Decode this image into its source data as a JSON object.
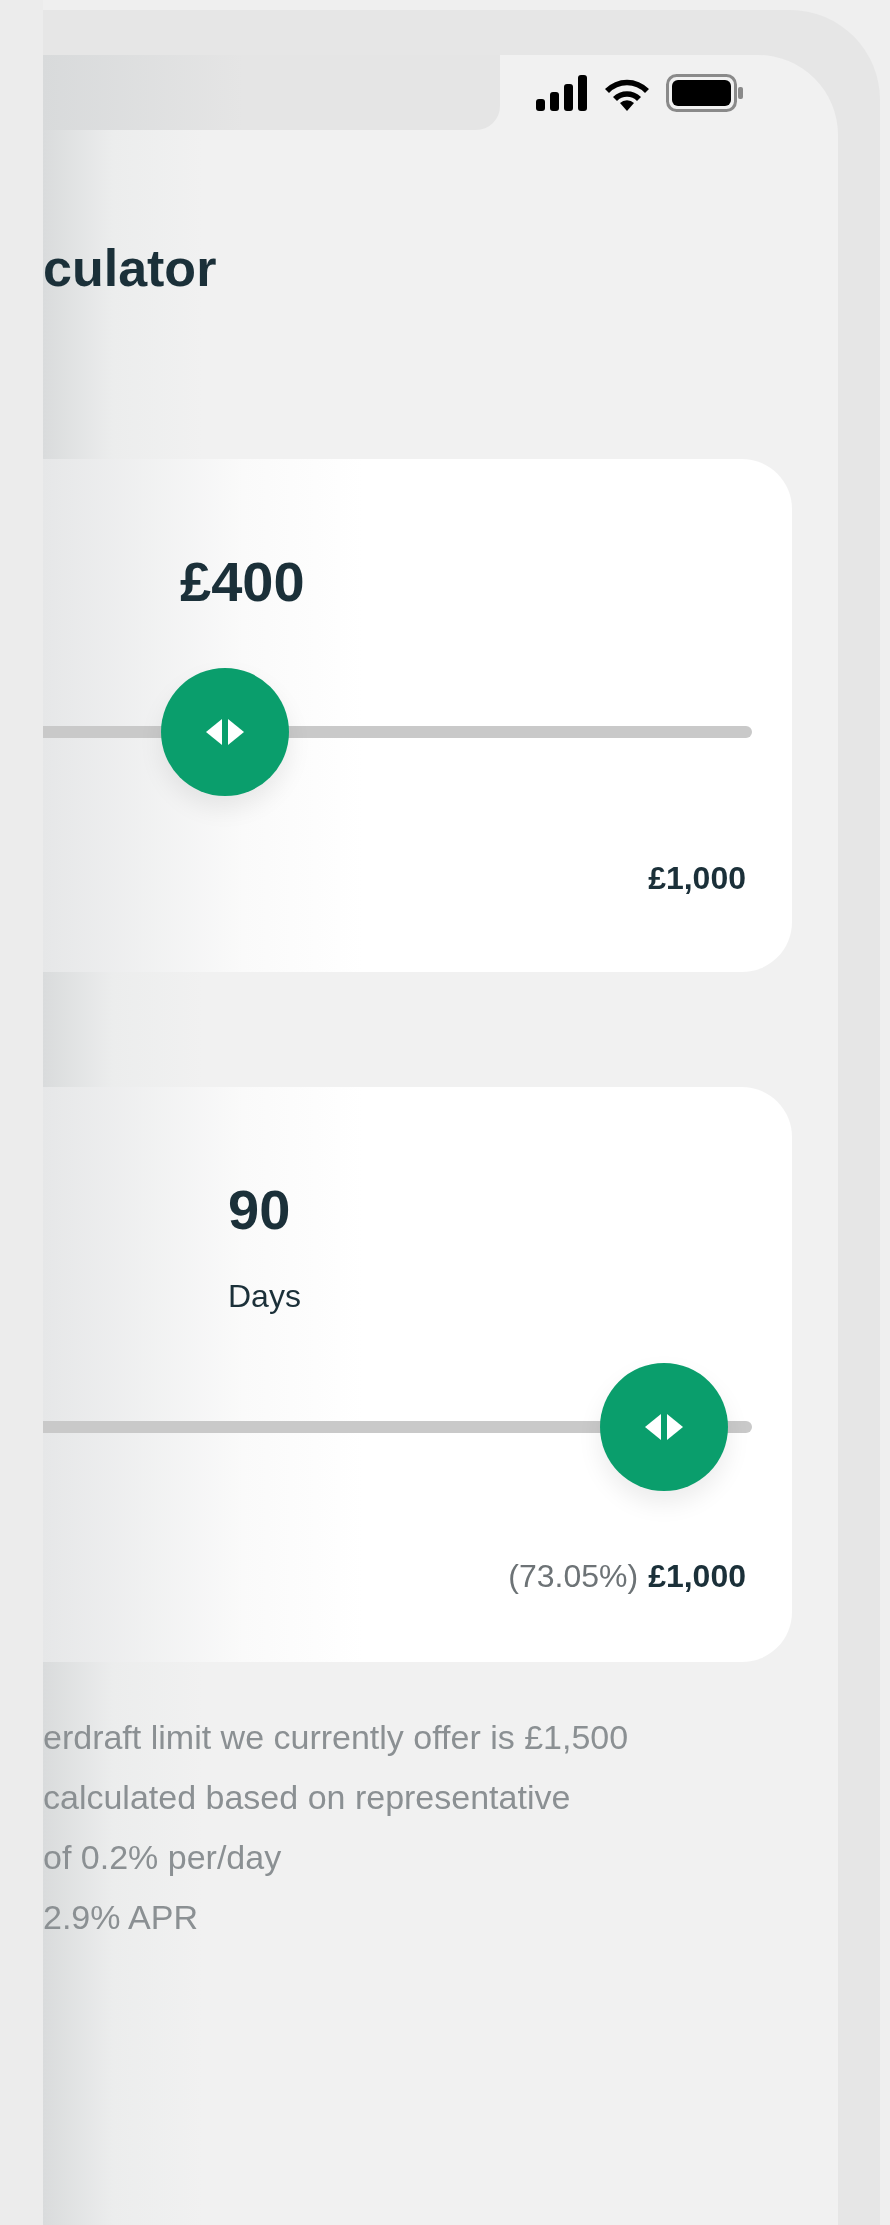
{
  "title": "culator",
  "sliders": [
    {
      "kind": "amount",
      "value": "£400",
      "level": 0.4,
      "max_label": "£1,000"
    },
    {
      "kind": "duration",
      "value": "90",
      "unit": "Days",
      "level": 0.9,
      "rate": "(73.05%)",
      "max_label": "£1,000"
    }
  ],
  "footnote_lines": [
    "erdraft limit we currently offer is £1,500",
    "calculated based on representative",
    "of 0.2% per/day",
    "2.9% APR"
  ]
}
